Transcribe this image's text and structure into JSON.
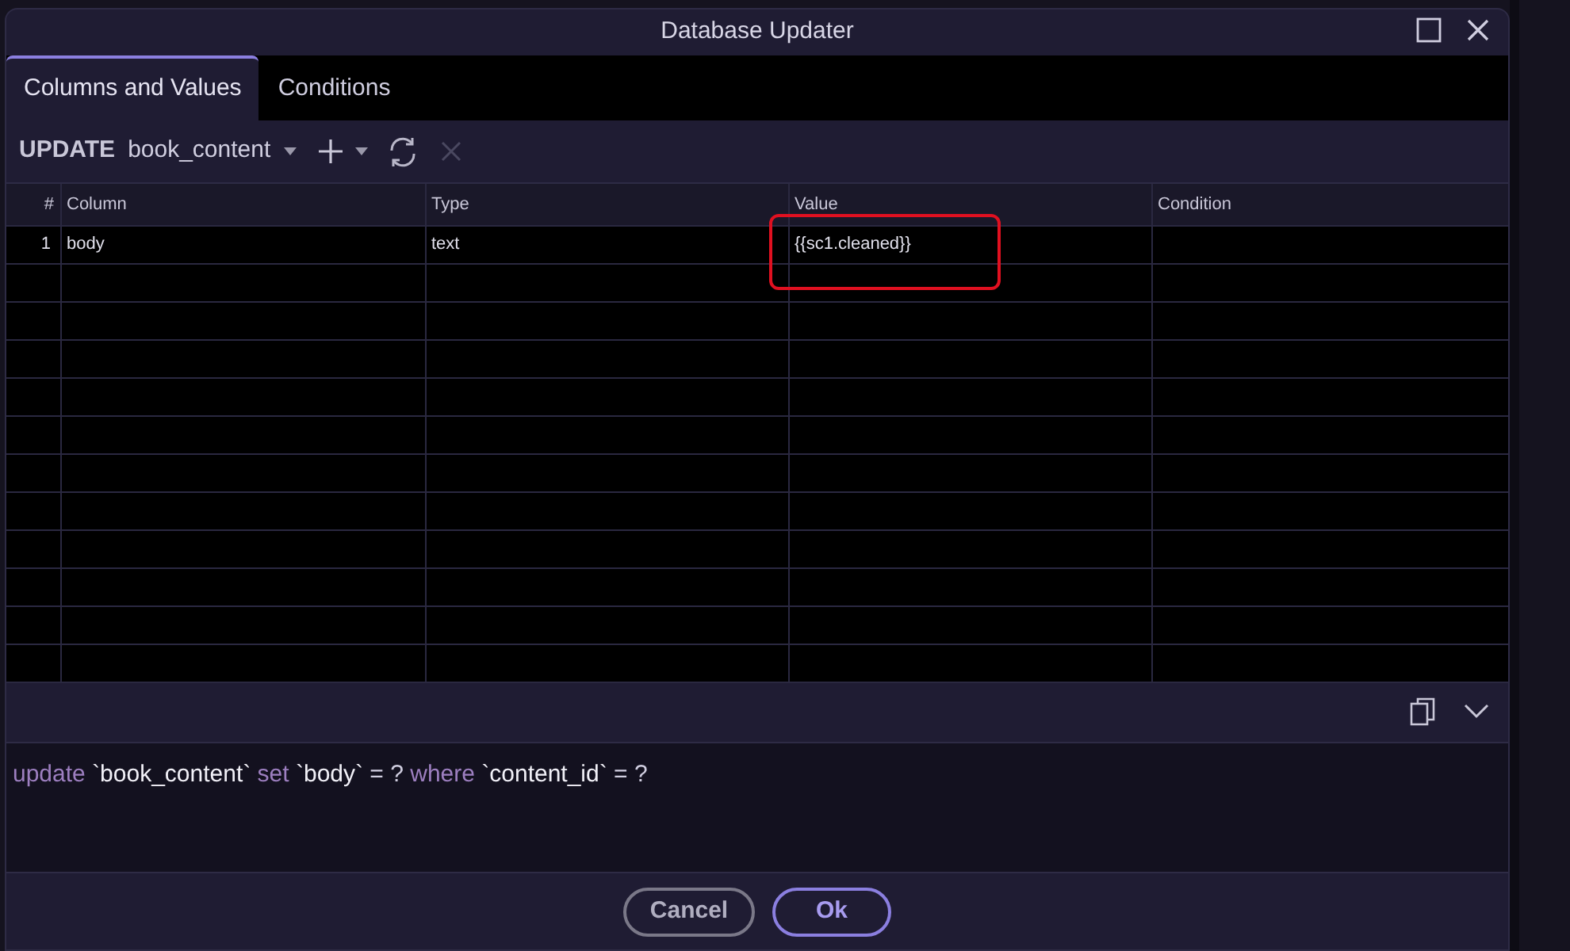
{
  "window": {
    "title": "Database Updater"
  },
  "tabs": [
    {
      "label": "Columns and Values",
      "selected": true
    },
    {
      "label": "Conditions",
      "selected": false
    }
  ],
  "toolbar": {
    "statement": "UPDATE",
    "table": "book_content",
    "delete_disabled": true
  },
  "table": {
    "columns": [
      "#",
      "Column",
      "Type",
      "Value",
      "Condition"
    ],
    "rows": [
      {
        "cells": [
          "1",
          "body",
          "text",
          "{{sc1.cleaned}}",
          ""
        ],
        "highlighted": [
          false,
          false,
          false,
          true,
          false
        ]
      }
    ]
  },
  "sql": [
    {
      "kind": "keyword",
      "text": "update"
    },
    {
      "kind": "identifier",
      "text": "`book_content`"
    },
    {
      "kind": "keyword",
      "text": "set"
    },
    {
      "kind": "identifier",
      "text": "`body`"
    },
    {
      "kind": "operator",
      "text": "= ?"
    },
    {
      "kind": "keyword",
      "text": "where"
    },
    {
      "kind": "identifier",
      "text": "`content_id`"
    },
    {
      "kind": "operator",
      "text": "= ?"
    }
  ],
  "buttons": [
    {
      "label": "Cancel",
      "kind": "secondary"
    },
    {
      "label": "Ok",
      "kind": "primary"
    }
  ]
}
